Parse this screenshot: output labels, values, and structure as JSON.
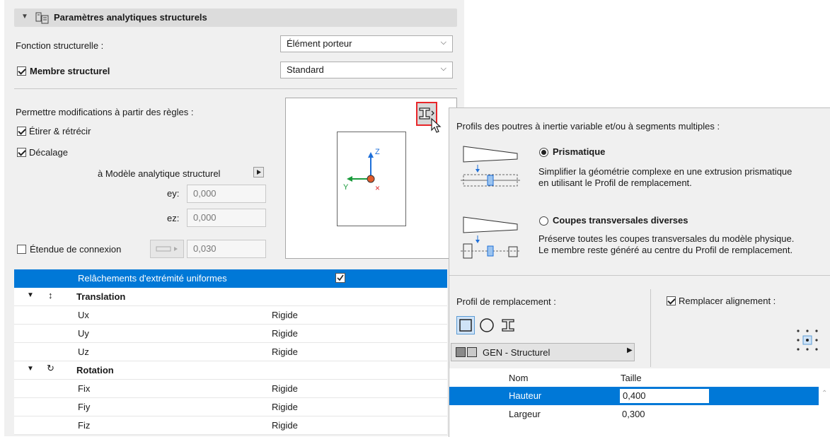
{
  "section": {
    "title": "Paramètres analytiques structurels"
  },
  "fonction": {
    "label": "Fonction structurelle :",
    "value": "Élément porteur"
  },
  "membre": {
    "label": "Membre structurel",
    "value": "Standard",
    "checked": true
  },
  "rules": {
    "label": "Permettre modifications à partir des règles :",
    "stretch": "Étirer & rétrécir",
    "offset": "Décalage",
    "to_model": "à Modèle analytique structurel",
    "ey_label": "ey:",
    "ey_value": "0,000",
    "ez_label": "ez:",
    "ez_value": "0,000"
  },
  "connexion": {
    "label": "Étendue de connexion",
    "value": "0,030"
  },
  "axes": {
    "z": "Z",
    "y": "Y",
    "x": "×"
  },
  "table": {
    "header": "Relâchements d'extrémité uniformes",
    "translation": "Translation",
    "rotation": "Rotation",
    "rows": [
      {
        "name": "Ux",
        "value": "Rigide"
      },
      {
        "name": "Uy",
        "value": "Rigide"
      },
      {
        "name": "Uz",
        "value": "Rigide"
      },
      {
        "name": "Fix",
        "value": "Rigide"
      },
      {
        "name": "Fiy",
        "value": "Rigide"
      },
      {
        "name": "Fiz",
        "value": "Rigide"
      }
    ]
  },
  "popup": {
    "title": "Profils des poutres à inertie variable et/ou à segments multiples :",
    "prismatic": {
      "label": "Prismatique",
      "desc1": "Simplifier la géométrie complexe en une extrusion prismatique",
      "desc2": "en utilisant le Profil de remplacement."
    },
    "various": {
      "label": "Coupes transversales diverses",
      "desc1": "Préserve toutes les coupes transversales du modèle physique.",
      "desc2": "Le membre reste généré au centre du Profil de remplacement."
    },
    "profile_label": "Profil de remplacement :",
    "replace_alignment": "Remplacer alignement :",
    "material": "GEN - Structurel",
    "col_name": "Nom",
    "col_size": "Taille",
    "rows": [
      {
        "name": "Hauteur",
        "value": "0,400"
      },
      {
        "name": "Largeur",
        "value": "0,300"
      }
    ]
  },
  "colors": {
    "accent": "#0078d7",
    "highlight": "#e8262a",
    "axis_z": "#1e6fd9",
    "axis_y": "#1a9b3c"
  }
}
